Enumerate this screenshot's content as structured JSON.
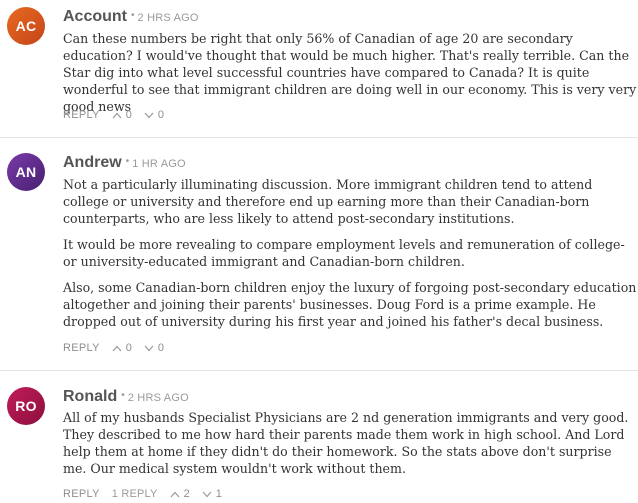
{
  "comments": [
    {
      "initials": "AC",
      "avatar_color": "#d0551c",
      "author": "Account",
      "separator": "•",
      "time": "2 HRS AGO",
      "paragraphs": [
        "Can these numbers be right that only 56% of Canadian of age 20 are secondary education? I would've thought that would be much higher. That's really terrible. Can the Star dig into what level successful countries have compared to Canada? It is quite wonderful to see that immigrant children are doing well in our economy. This is very very good news"
      ],
      "reply_label": "REPLY",
      "replies_count_label": "",
      "upvotes": "0",
      "downvotes": "0"
    },
    {
      "initials": "AN",
      "avatar_color": "#5b2a86",
      "author": "Andrew",
      "separator": "•",
      "time": "1 HR AGO",
      "paragraphs": [
        "Not a particularly illuminating discussion. More immigrant children tend to attend college or university and therefore end up earning more than their Canadian-born counterparts, who are less likely to attend post-secondary institutions.",
        "It would be more revealing to compare employment levels and remuneration of college- or university-educated immigrant and Canadian-born children.",
        "Also, some Canadian-born children enjoy the luxury of forgoing post-secondary education altogether and joining their parents' businesses. Doug Ford is a prime example. He dropped out of university during his first year and joined his father's decal business."
      ],
      "reply_label": "REPLY",
      "replies_count_label": "",
      "upvotes": "0",
      "downvotes": "0"
    },
    {
      "initials": "RO",
      "avatar_color": "#a3154a",
      "author": "Ronald",
      "separator": "•",
      "time": "2 HRS AGO",
      "paragraphs": [
        "All of my husbands Specialist Physicians are 2 nd generation immigrants and very good. They described to me how hard their parents made them work in high school. And Lord help them at home if they didn't do their homework. So the stats above don't surprise me. Our medical system wouldn't work without them."
      ],
      "reply_label": "REPLY",
      "replies_count_label": "1 REPLY",
      "upvotes": "2",
      "downvotes": "1"
    }
  ]
}
